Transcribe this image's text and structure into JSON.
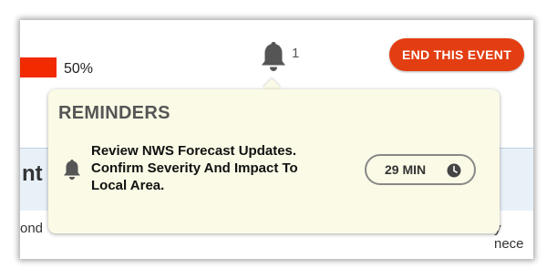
{
  "header": {
    "progress_text": "50%",
    "progress_value": 0.5,
    "notification_count": "1",
    "end_event_label": "END THIS EVENT",
    "accent_color": "#e33d12"
  },
  "background": {
    "band_text": "nt S",
    "body_text_left": "ond",
    "body_text_right": "y nece"
  },
  "reminders": {
    "title": "REMINDERS",
    "items": [
      {
        "text": "Review NWS Forecast Updates. Confirm Severity And Impact To Local Area.",
        "time": "29 MIN",
        "icon": "bell-icon"
      }
    ]
  }
}
